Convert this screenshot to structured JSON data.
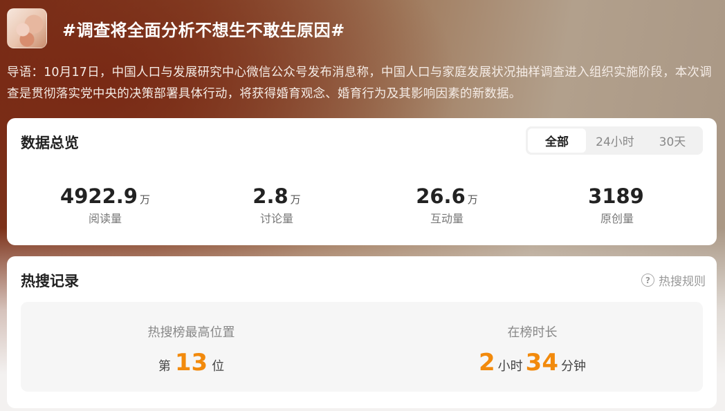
{
  "topic": {
    "title": "#调查将全面分析不想生不敢生原因#",
    "intro": "导语：10月17日，中国人口与发展研究中心微信公众号发布消息称，中国人口与家庭发展状况抽样调查进入组织实施阶段，本次调查是贯彻落实党中央的决策部署具体行动，将获得婚育观念、婚育行为及其影响因素的新数据。"
  },
  "overview": {
    "title": "数据总览",
    "tabs": [
      "全部",
      "24小时",
      "30天"
    ],
    "active_tab": "全部",
    "stats": [
      {
        "value": "4922.9",
        "unit": "万",
        "label": "阅读量"
      },
      {
        "value": "2.8",
        "unit": "万",
        "label": "讨论量"
      },
      {
        "value": "26.6",
        "unit": "万",
        "label": "互动量"
      },
      {
        "value": "3189",
        "unit": "",
        "label": "原创量"
      }
    ]
  },
  "hot_search": {
    "title": "热搜记录",
    "rules_link": "热搜规则",
    "rules_icon": "question-circle-icon",
    "highest_position": {
      "label": "热搜榜最高位置",
      "prefix": "第",
      "value": "13",
      "suffix": "位"
    },
    "duration": {
      "label": "在榜时长",
      "hours": "2",
      "hours_unit": "小时",
      "minutes": "34",
      "minutes_unit": "分钟"
    }
  },
  "colors": {
    "accent_orange": "#f28a0c",
    "hero_brown": "#7a3018"
  }
}
